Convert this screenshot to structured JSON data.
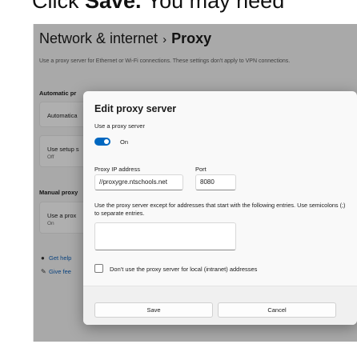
{
  "instruction": {
    "prefix": "Click ",
    "bold": "Save.",
    "suffix": " You may need"
  },
  "settings": {
    "breadcrumb_parent": "Network & internet",
    "breadcrumb_separator": "›",
    "breadcrumb_current": "Proxy",
    "description": "Use a proxy server for Ethernet or Wi-Fi connections. These settings don't apply to VPN connections.",
    "automatic_section": "Automatic pr",
    "automatic_card_title": "Automatica",
    "setup_script_title": "Use setup s",
    "setup_script_status": "Off",
    "manual_section": "Manual proxy",
    "manual_card_title": "Use a prox",
    "manual_card_status": "On",
    "get_help": "Get help",
    "give_feedback": "Give fee"
  },
  "dialog": {
    "title": "Edit proxy server",
    "use_proxy_label": "Use a proxy server",
    "toggle_state": "On",
    "ip_label": "Proxy IP address",
    "ip_value": "//proxygre.ntschools.net",
    "port_label": "Port",
    "port_value": "8080",
    "exceptions_text": "Use the proxy server except for addresses that start with the following entries. Use semicolons (;) to separate entries.",
    "exceptions_value": "",
    "local_checkbox_label": "Don't use the proxy server for local (intranet) addresses",
    "local_checkbox_checked": false,
    "save_label": "Save",
    "cancel_label": "Cancel"
  },
  "colors": {
    "accent": "#0067c0",
    "link": "#0f5fb5"
  }
}
